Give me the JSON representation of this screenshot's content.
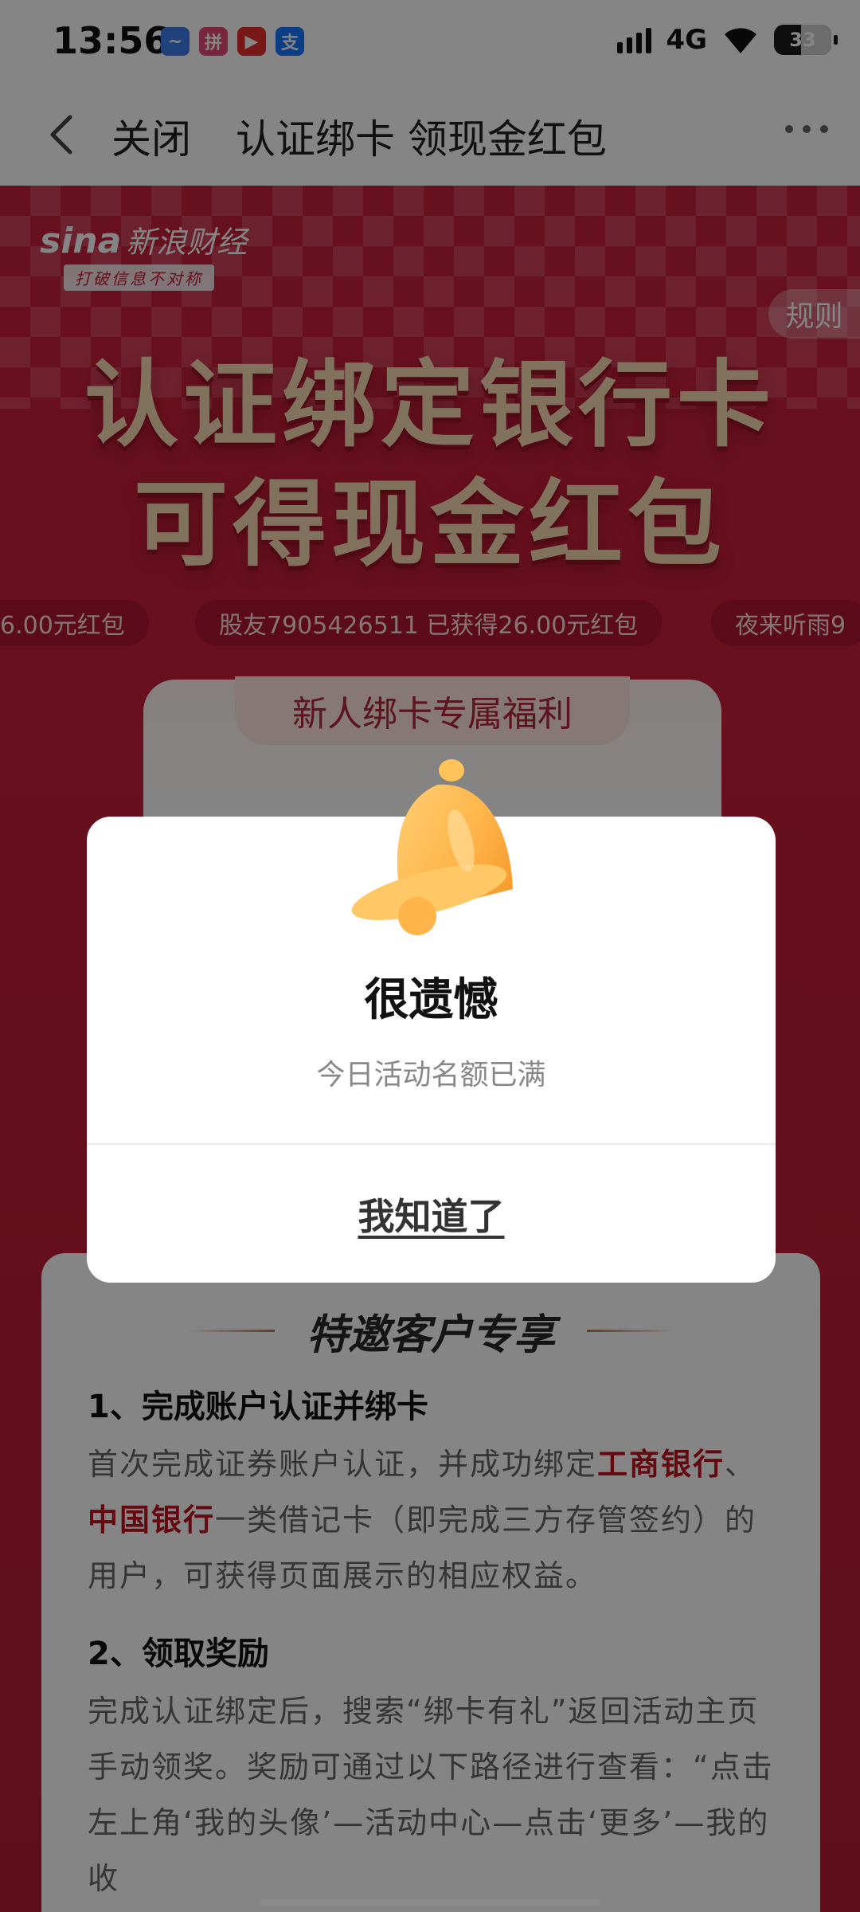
{
  "status_bar": {
    "time": "13:56",
    "network": "4G",
    "battery": "33",
    "app_icons": [
      {
        "icon": "app-blue-icon",
        "color": "#3f7de8",
        "glyph": "~"
      },
      {
        "icon": "app-pink-icon",
        "color": "#e74a7a",
        "glyph": "拼"
      },
      {
        "icon": "video-app-icon",
        "color": "#e8302c",
        "glyph": "▶"
      },
      {
        "icon": "alipay-icon",
        "color": "#1677ff",
        "glyph": "支"
      }
    ]
  },
  "navbar": {
    "close_label": "关闭",
    "title": "认证绑卡 领现金红包"
  },
  "page": {
    "brand": {
      "logo": "sina",
      "name": "新浪财经",
      "tagline": "打破信息不对称"
    },
    "rules_button": "规则",
    "hero": [
      "认证绑定银行卡",
      "可得现金红包"
    ],
    "ticker": [
      "6.00元红包",
      "股友7905426511 已获得26.00元红包",
      "夜来听雨9"
    ],
    "welfare_title": "新人绑卡专属福利",
    "rules_card": {
      "title": "特邀客户专享",
      "section1_title": "1、完成账户认证并绑卡",
      "section1_text_a": "首次完成证券账户认证，并成功绑定",
      "section1_bank1": "工商银行",
      "section1_sep": "、",
      "section1_bank2": "中国银行",
      "section1_text_b": "一类借记卡（即完成三方存管签约）的用户，可获得页面展示的相应权益。",
      "section2_title": "2、领取奖励",
      "section2_text": "完成认证绑定后，搜索“绑卡有礼”返回活动主页手动领奖。奖励可通过以下路径进行查看：“点击左上角‘我的头像’—活动中心—点击‘更多’—我的收"
    }
  },
  "dialog": {
    "icon": "bell-icon",
    "title": "很遗憾",
    "message": "今日活动名额已满",
    "button": "我知道了"
  },
  "colors": {
    "page_red": "#c91f3c",
    "highlight_red": "#c1121f",
    "hero_gold": "#f5dab2",
    "bell_orange": "#ffb54a"
  }
}
